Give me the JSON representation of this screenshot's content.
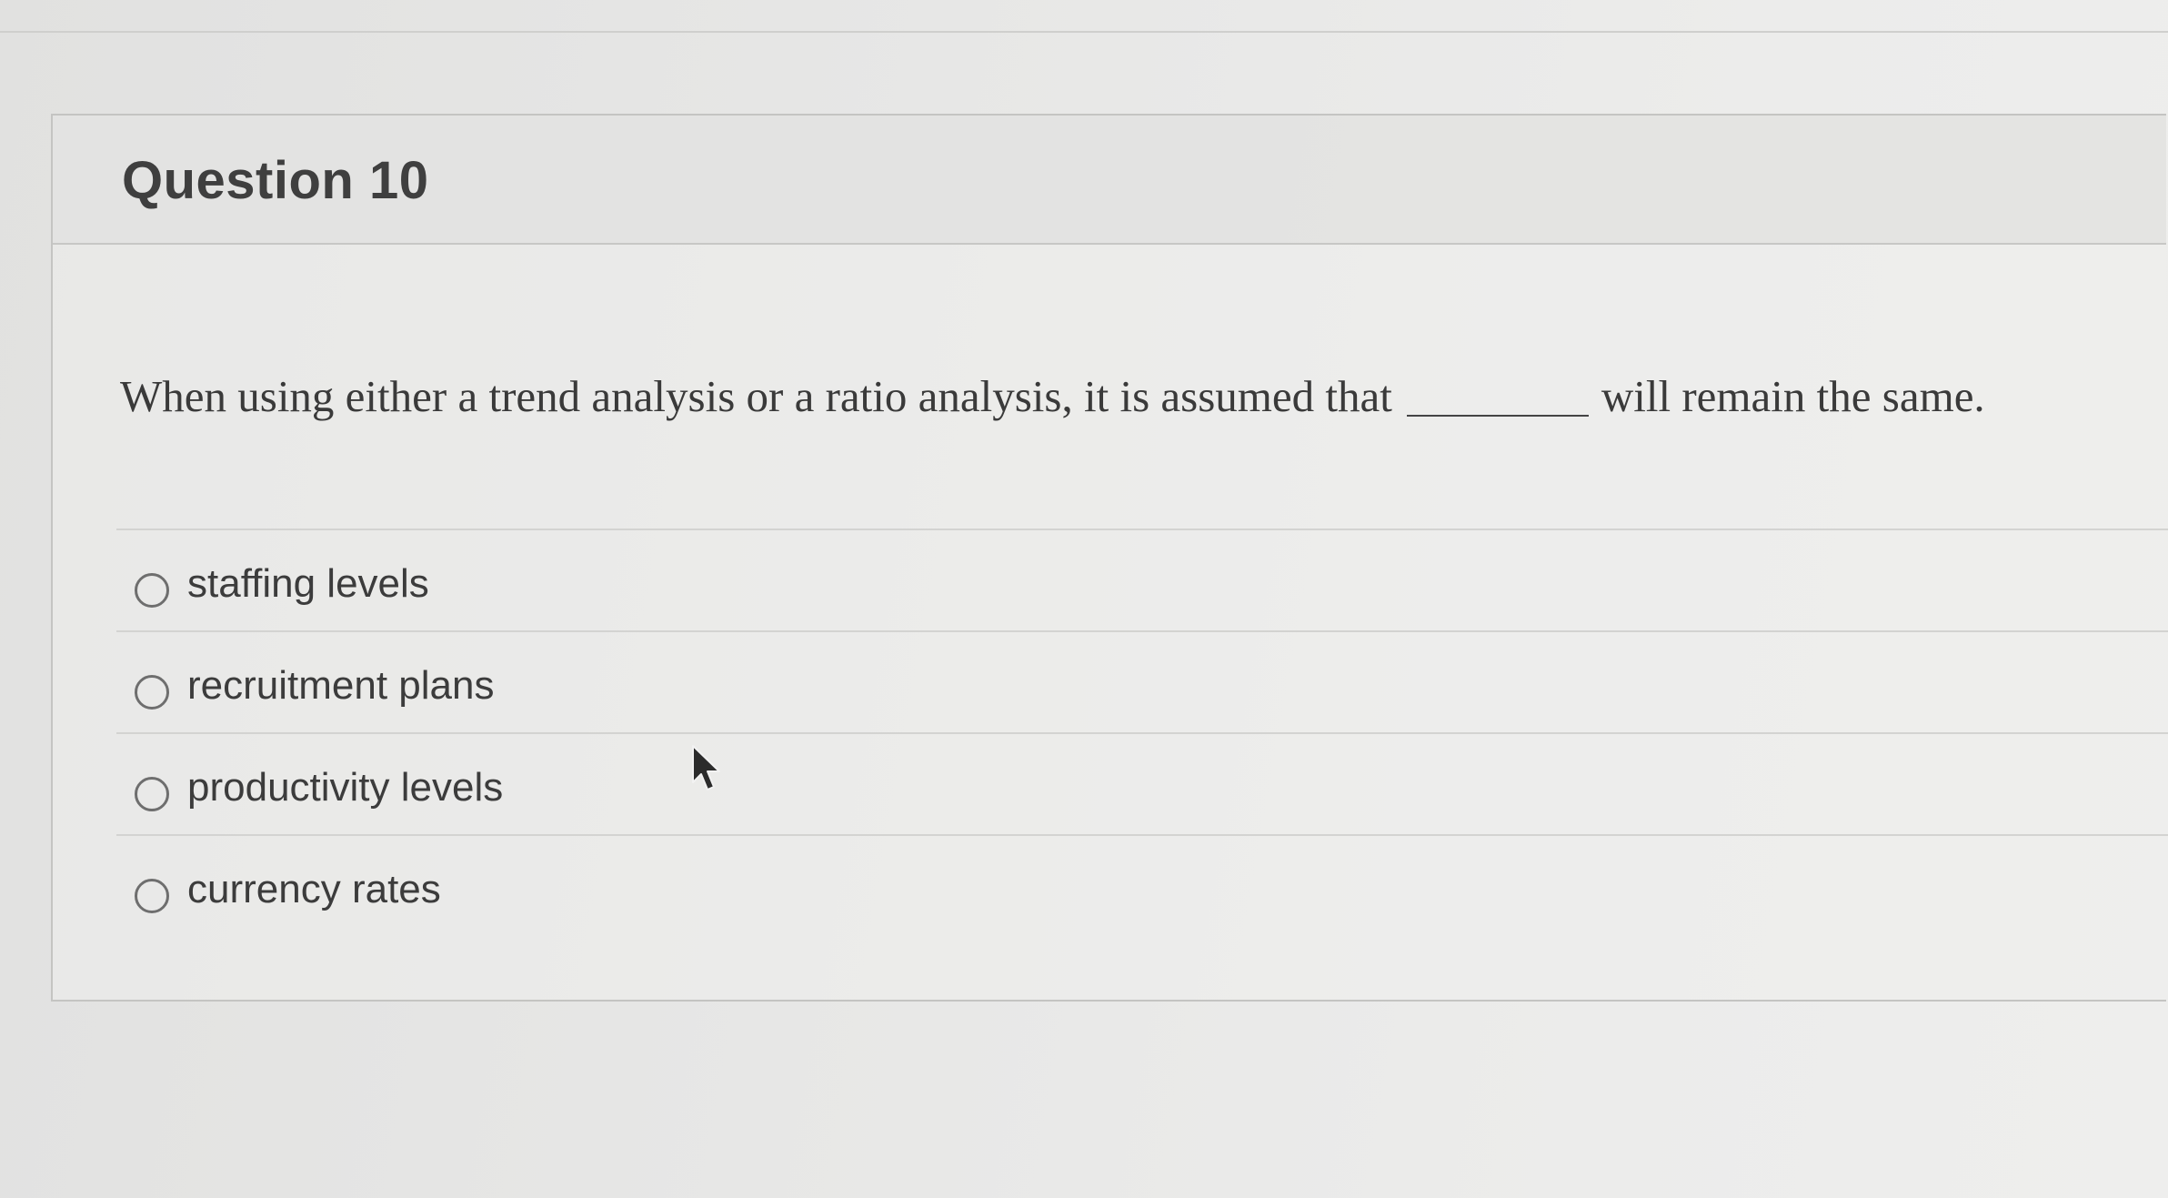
{
  "question": {
    "title": "Question 10",
    "text_before_blank": "When using either a trend analysis or a ratio analysis, it is assumed that",
    "text_after_blank": "will remain the same."
  },
  "answers": [
    {
      "label": "staffing levels",
      "selected": false
    },
    {
      "label": "recruitment plans",
      "selected": false
    },
    {
      "label": "productivity levels",
      "selected": false
    },
    {
      "label": "currency rates",
      "selected": false
    }
  ],
  "icons": {
    "radio": "radio-button-icon",
    "cursor": "mouse-pointer-icon"
  }
}
